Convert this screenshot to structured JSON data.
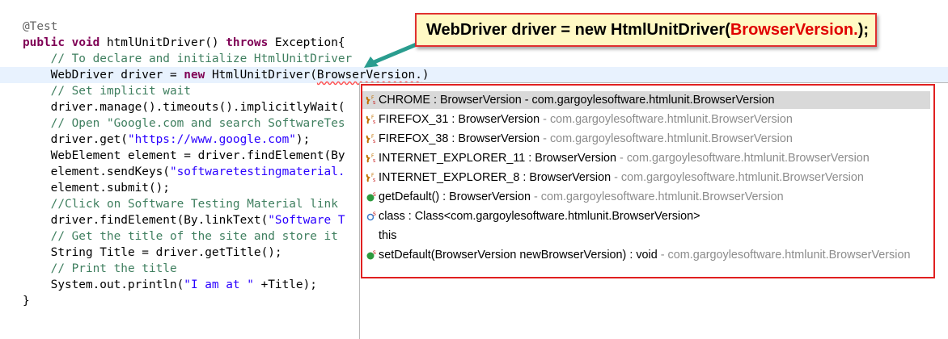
{
  "code": {
    "line1": "@Test",
    "line2_kw1": "public",
    "line2_kw2": "void",
    "line2_mid": " htmlUnitDriver() ",
    "line2_kw3": "throws",
    "line2_end": " Exception{",
    "line3": "    // To declare and initialize HtmlUnitDriver",
    "line4_a": "    WebDriver driver = ",
    "line4_kw": "new",
    "line4_b": " HtmlUnitDriver(",
    "line4_err": "BrowserVersion.",
    "line4_c": ")",
    "line5": "    // Set implicit wait",
    "line6": "    driver.manage().timeouts().implicitlyWait(",
    "line7": "    // Open \"Google.com and search SoftwareTes",
    "line8_a": "    driver.get(",
    "line8_s": "\"https://www.google.com\"",
    "line8_b": ");",
    "line9": "    WebElement element = driver.findElement(By",
    "line10_a": "    element.sendKeys(",
    "line10_s": "\"softwaretestingmaterial.",
    "line11": "    element.submit();",
    "line12": "    //Click on Software Testing Material link",
    "line13_a": "    driver.findElement(By.linkText(",
    "line13_s": "\"Software T",
    "line14": "    // Get the title of the site and store it",
    "line15": "    String Title = driver.getTitle();",
    "line16": "    // Print the title",
    "line17_a": "    System.out.println(",
    "line17_s": "\"I am at \"",
    "line17_b": " +Title);",
    "line18": "}"
  },
  "callout": {
    "prefix": "WebDriver driver = new HtmlUnitDriver(",
    "highlight": "BrowserVersion.",
    "suffix": ");"
  },
  "proposals": [
    {
      "main": "CHROME : BrowserVersion - com.gargoylesoftware.htmlunit.BrowserVersion",
      "qual": "",
      "icon": "static-field-icon"
    },
    {
      "main": "FIREFOX_31 : BrowserVersion",
      "qual": " - com.gargoylesoftware.htmlunit.BrowserVersion",
      "icon": "static-field-icon"
    },
    {
      "main": "FIREFOX_38 : BrowserVersion",
      "qual": " - com.gargoylesoftware.htmlunit.BrowserVersion",
      "icon": "static-field-icon"
    },
    {
      "main": "INTERNET_EXPLORER_11 : BrowserVersion",
      "qual": " - com.gargoylesoftware.htmlunit.BrowserVersion",
      "icon": "static-field-icon"
    },
    {
      "main": "INTERNET_EXPLORER_8 : BrowserVersion",
      "qual": " - com.gargoylesoftware.htmlunit.BrowserVersion",
      "icon": "static-field-icon"
    },
    {
      "main": "getDefault() : BrowserVersion",
      "qual": " - com.gargoylesoftware.htmlunit.BrowserVersion",
      "icon": "static-method-icon"
    },
    {
      "main": "class : Class<com.gargoylesoftware.htmlunit.BrowserVersion>",
      "qual": "",
      "icon": "static-class-icon"
    },
    {
      "main": "this",
      "qual": "",
      "icon": ""
    },
    {
      "main": "setDefault(BrowserVersion newBrowserVersion) : void",
      "qual": " - com.gargoylesoftware.htmlunit.BrowserVersion",
      "icon": "static-method-icon"
    }
  ],
  "colors": {
    "keyword": "#7f0055",
    "comment": "#3f7f5f",
    "string": "#2a00ff",
    "highlight_red": "#e00000",
    "callout_bg": "#fff9c4",
    "arrow": "#2a9d8f"
  }
}
